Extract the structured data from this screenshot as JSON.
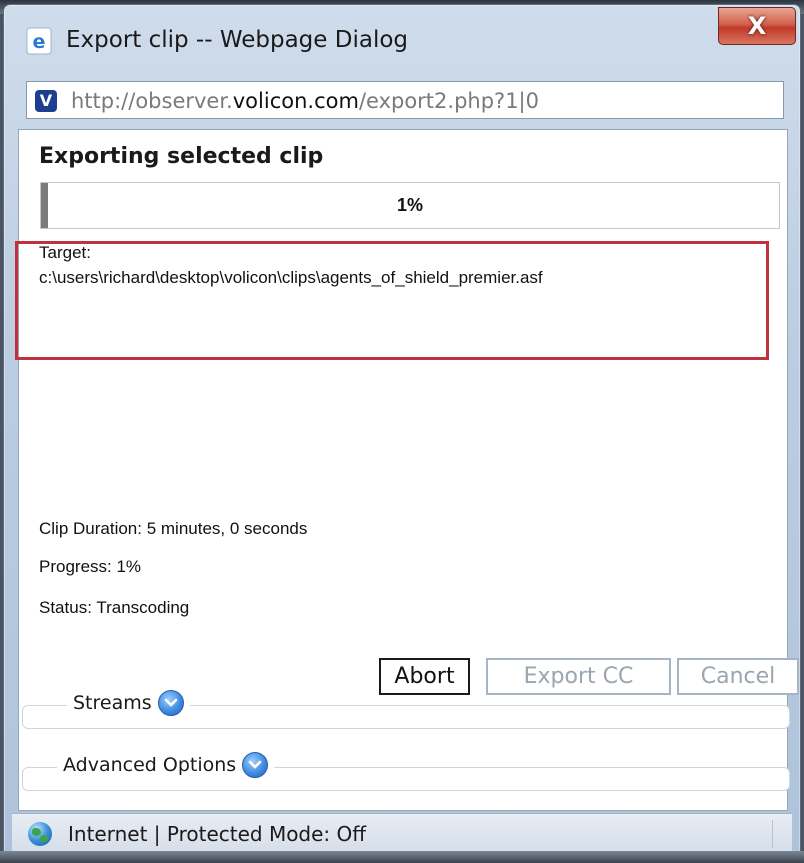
{
  "window": {
    "title": "Export clip -- Webpage Dialog",
    "close_label": "X"
  },
  "address": {
    "site_icon_letter": "V",
    "url_prefix": "http://observer.",
    "url_domain": "volicon.com",
    "url_suffix": "/export2.php?1|0"
  },
  "dialog": {
    "heading": "Exporting selected clip",
    "progress_value": 0.01,
    "progress_label": "1%",
    "target_label": "Target:",
    "target_path": "c:\\users\\richard\\desktop\\volicon\\clips\\agents_of_shield_premier.asf",
    "clip_duration": "Clip Duration: 5 minutes, 0  seconds",
    "progress_text": "Progress: 1%",
    "status_text": "Status: Transcoding",
    "highlight_color": "#c0313d"
  },
  "buttons": {
    "abort": "Abort",
    "export_cc": "Export CC",
    "cancel": "Cancel"
  },
  "sections": {
    "streams": "Streams",
    "advanced": "Advanced Options"
  },
  "statusbar": {
    "text": "Internet | Protected Mode: Off"
  },
  "icons": {
    "title": "ie-icon",
    "site": "volicon-icon",
    "expand": "chevron-down-icon",
    "zone": "globe-icon"
  }
}
